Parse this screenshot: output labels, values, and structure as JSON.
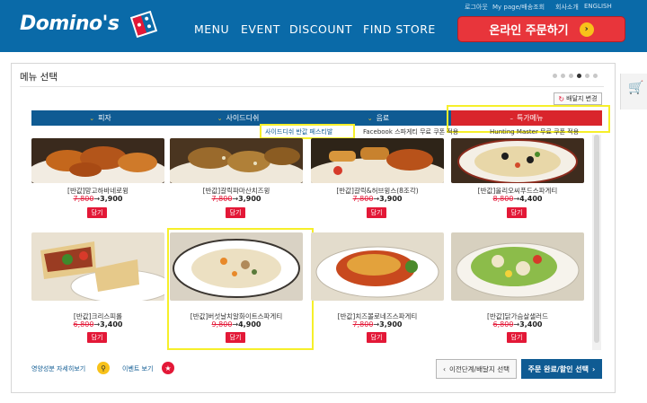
{
  "header": {
    "logo_text": "Domino's",
    "nav": [
      "MENU",
      "EVENT",
      "DISCOUNT",
      "FIND STORE"
    ],
    "util_links": [
      "로그아웃",
      "My page/배송조회",
      "회사소개",
      "ENGLISH"
    ],
    "order_button": "온라인 주문하기",
    "order_arrow": "›",
    "brand_blue": "#0a6aa8",
    "brand_red": "#e31837"
  },
  "panel": {
    "title": "메뉴 선택",
    "change_address": "배달지 변경",
    "change_address_icon": "↻",
    "pager_active_index": 3
  },
  "tabs": [
    {
      "label": "피자",
      "chevron": "⌄"
    },
    {
      "label": "사이드디쉬",
      "chevron": "⌄"
    },
    {
      "label": "음료",
      "chevron": "⌄"
    },
    {
      "label": "특가메뉴",
      "chevron": "–"
    }
  ],
  "subnav": [
    "사이드디쉬 반값 페스티발",
    "Facebook 스파게티 무료 쿠폰 적용",
    "Hunting Master 무료 쿠폰 적용"
  ],
  "products": [
    {
      "name": "[반값]망고하바네로윙",
      "old_price": "7,800",
      "new_price": "3,900",
      "buy": "담기"
    },
    {
      "name": "[반값]갈릭파마산치즈윙",
      "old_price": "7,800",
      "new_price": "3,900",
      "buy": "담기"
    },
    {
      "name": "[반값]갈릭&허브윙스(8조각)",
      "old_price": "7,800",
      "new_price": "3,900",
      "buy": "담기"
    },
    {
      "name": "[반값]올리오씨푸드스파게티",
      "old_price": "8,800",
      "new_price": "4,400",
      "buy": "담기"
    },
    {
      "name": "[반값]크리스피롤",
      "old_price": "6,800",
      "new_price": "3,400",
      "buy": "담기"
    },
    {
      "name": "[반값]버섯날치알화이트스파게티",
      "old_price": "9,800",
      "new_price": "4,900",
      "buy": "담기"
    },
    {
      "name": "[반값]치즈볼로네즈스파게티",
      "old_price": "7,800",
      "new_price": "3,900",
      "buy": "담기"
    },
    {
      "name": "[반값]닭가슴살샐러드",
      "old_price": "6,800",
      "new_price": "3,400",
      "buy": "담기"
    }
  ],
  "price_arrow": "→",
  "footer": {
    "nutrition_link": "영양성분 자세히보기",
    "event_link": "이벤트 보기",
    "prev_button": "이전단계/배달지 선택",
    "next_button": "주문 완료/할인 선택",
    "prev_icon": "‹",
    "next_icon": "›"
  }
}
